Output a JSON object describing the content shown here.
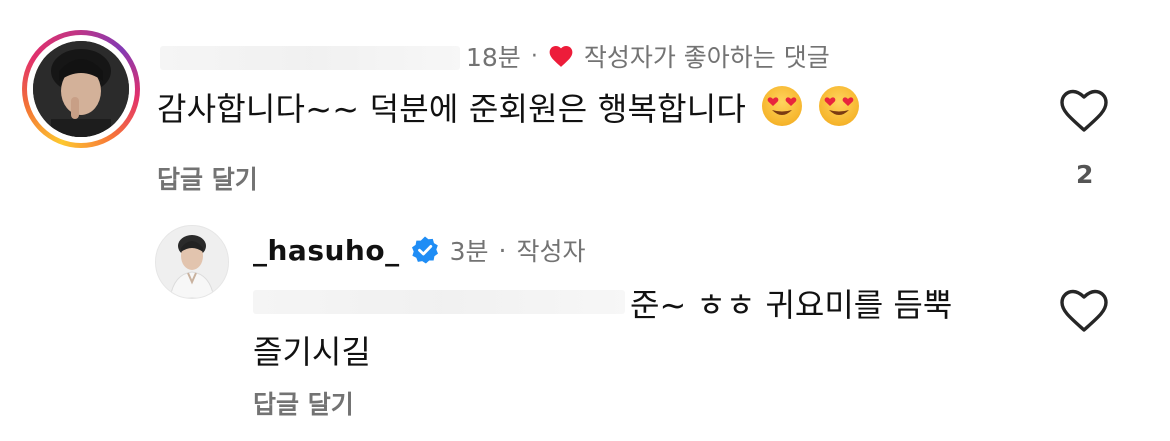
{
  "top_comment": {
    "time": "18분",
    "separator": "·",
    "liked_by_author": "작성자가 좋아하는 댓글",
    "text": "감사합니다~~ 덕분에 준회원은 행복합니다",
    "emojis": [
      "heart-eyes-emoji",
      "heart-eyes-emoji"
    ],
    "reply_label": "답글 달기",
    "like_count": "2",
    "like_icon": "heart-outline-icon",
    "liked_heart_color": "#ed1c3a"
  },
  "reply_comment": {
    "username": "_hasuho_",
    "verified_icon": "verified-badge-icon",
    "verified_color": "#1f8df5",
    "time": "3분",
    "separator": "·",
    "author_label": "작성자",
    "text_line1": "준~ ㅎㅎ 귀요미를 듬뿍",
    "text_line2": "즐기시길",
    "reply_label": "답글 달기",
    "like_icon": "heart-outline-icon"
  }
}
